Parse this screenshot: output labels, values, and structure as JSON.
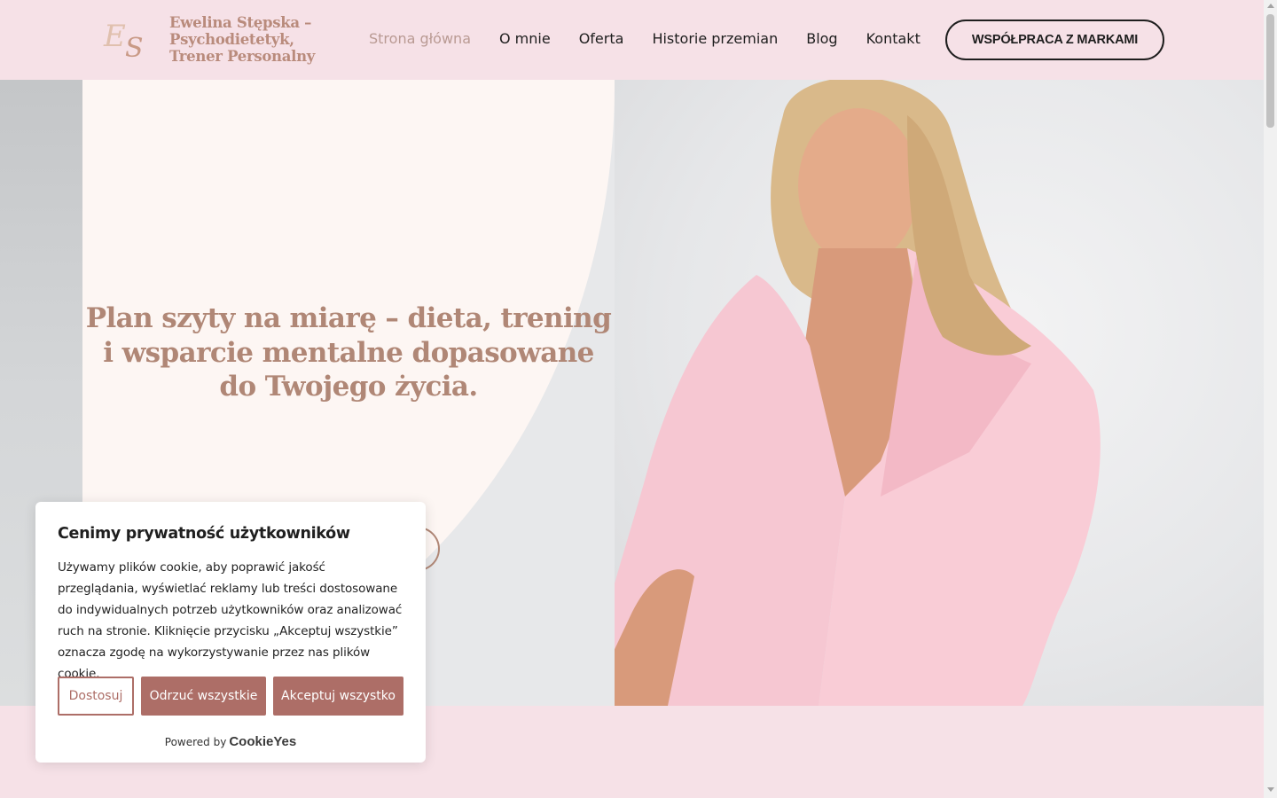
{
  "header": {
    "logo_monogram": "ES",
    "site_title": "Ewelina Stępska – Psychodietetyk, Trener Personalny",
    "nav": [
      {
        "label": "Strona główna",
        "active": true
      },
      {
        "label": "O mnie",
        "active": false
      },
      {
        "label": "Oferta",
        "active": false
      },
      {
        "label": "Historie przemian",
        "active": false
      },
      {
        "label": "Blog",
        "active": false
      },
      {
        "label": "Kontakt",
        "active": false
      }
    ],
    "cta_label": "WSPÓŁPRACA Z MARKAMI"
  },
  "hero": {
    "title": "Plan szyty na miarę – dieta, trening i wsparcie mentalne dopasowane do Twojego życia."
  },
  "cookie": {
    "title": "Cenimy prywatność użytkowników",
    "body": "Używamy plików cookie, aby poprawić jakość przeglądania, wyświetlać reklamy lub treści dostosowane do indywidualnych potrzeb użytkowników oraz analizować ruch na stronie. Kliknięcie przycisku „Akceptuj wszystkie” oznacza zgodę na wykorzystywanie przez nas plików cookie.",
    "customize_label": "Dostosuj",
    "reject_label": "Odrzuć wszystkie",
    "accept_label": "Akceptuj wszystko",
    "powered_by": "Powered by",
    "brand": "CookieYes"
  },
  "colors": {
    "header_bg": "#f6e1e7",
    "accent": "#b08776",
    "cookie_button": "#ad6e67"
  }
}
